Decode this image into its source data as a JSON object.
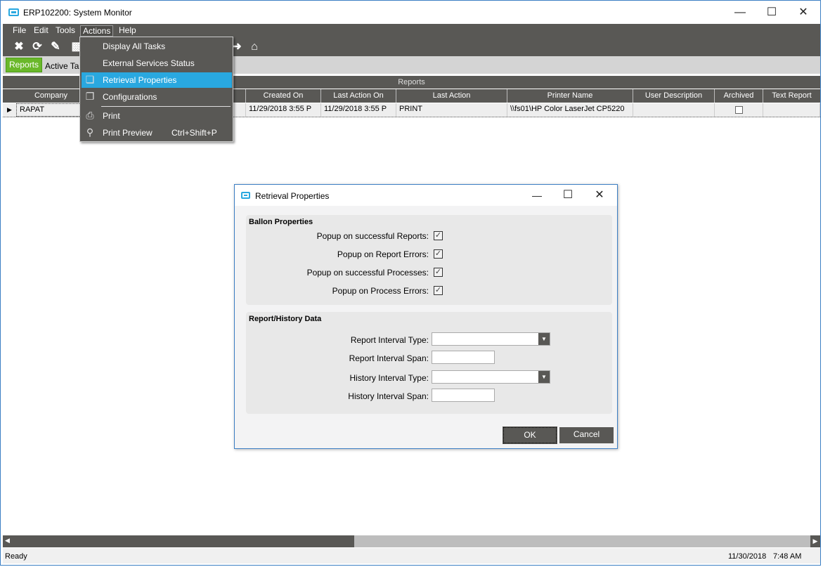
{
  "window": {
    "title": "ERP102200: System Monitor",
    "controls": [
      "minimize",
      "maximize",
      "close"
    ]
  },
  "menubar": {
    "items": [
      "File",
      "Edit",
      "Tools",
      "Actions",
      "Help"
    ],
    "open": "Actions"
  },
  "toolbar": {
    "icons": [
      "close-x-icon",
      "refresh-icon",
      "broom-icon",
      "print-icon",
      "forward-icon",
      "home-icon"
    ]
  },
  "tabs": [
    {
      "label": "Reports",
      "active": true
    },
    {
      "label": "Active Ta"
    }
  ],
  "grid": {
    "group_label": "Reports",
    "columns": [
      "Company",
      "",
      "Created On",
      "Last Action On",
      "Last Action",
      "Printer Name",
      "User Description",
      "Archived",
      "Text Report"
    ],
    "rows": [
      {
        "company": "RAPAT",
        "hidden": "",
        "created_on": "11/29/2018 3:55 P",
        "last_action_on": "11/29/2018 3:55 P",
        "last_action": "PRINT",
        "printer_name": "\\\\fs01\\HP Color LaserJet CP5220",
        "user_description": "",
        "archived": false,
        "text_report": ""
      }
    ]
  },
  "actions_menu": {
    "items": [
      {
        "label": "Display All Tasks",
        "icon": "",
        "shortcut": ""
      },
      {
        "label": "External Services Status",
        "icon": "",
        "shortcut": ""
      },
      {
        "label": "Retrieval  Properties",
        "icon": "window-icon",
        "shortcut": "",
        "selected": true
      },
      {
        "label": "Configurations",
        "icon": "windows-icon",
        "shortcut": ""
      },
      {
        "label": "Print",
        "icon": "printer-icon",
        "shortcut": ""
      },
      {
        "label": "Print Preview",
        "icon": "print-preview-icon",
        "shortcut": "Ctrl+Shift+P"
      }
    ]
  },
  "dialog": {
    "title": "Retrieval Properties",
    "balloon": {
      "heading": "Ballon Properties",
      "items": [
        {
          "label": "Popup on successful Reports:",
          "checked": true
        },
        {
          "label": "Popup on Report Errors:",
          "checked": true
        },
        {
          "label": "Popup on successful Processes:",
          "checked": true
        },
        {
          "label": "Popup on Process Errors:",
          "checked": true
        }
      ]
    },
    "history": {
      "heading": "Report/History Data",
      "report_interval_type": {
        "label": "Report Interval Type:",
        "value": ""
      },
      "report_interval_span": {
        "label": "Report Interval Span:",
        "value": ""
      },
      "history_interval_type": {
        "label": "History Interval Type:",
        "value": ""
      },
      "history_interval_span": {
        "label": "History Interval Span:",
        "value": ""
      }
    },
    "ok_label": "OK",
    "cancel_label": "Cancel"
  },
  "status": {
    "text": "Ready",
    "date": "11/30/2018",
    "time": "7:48 AM"
  },
  "colors": {
    "accent": "#29a8e0",
    "tab_active": "#6ab82a",
    "chrome": "#595855"
  }
}
